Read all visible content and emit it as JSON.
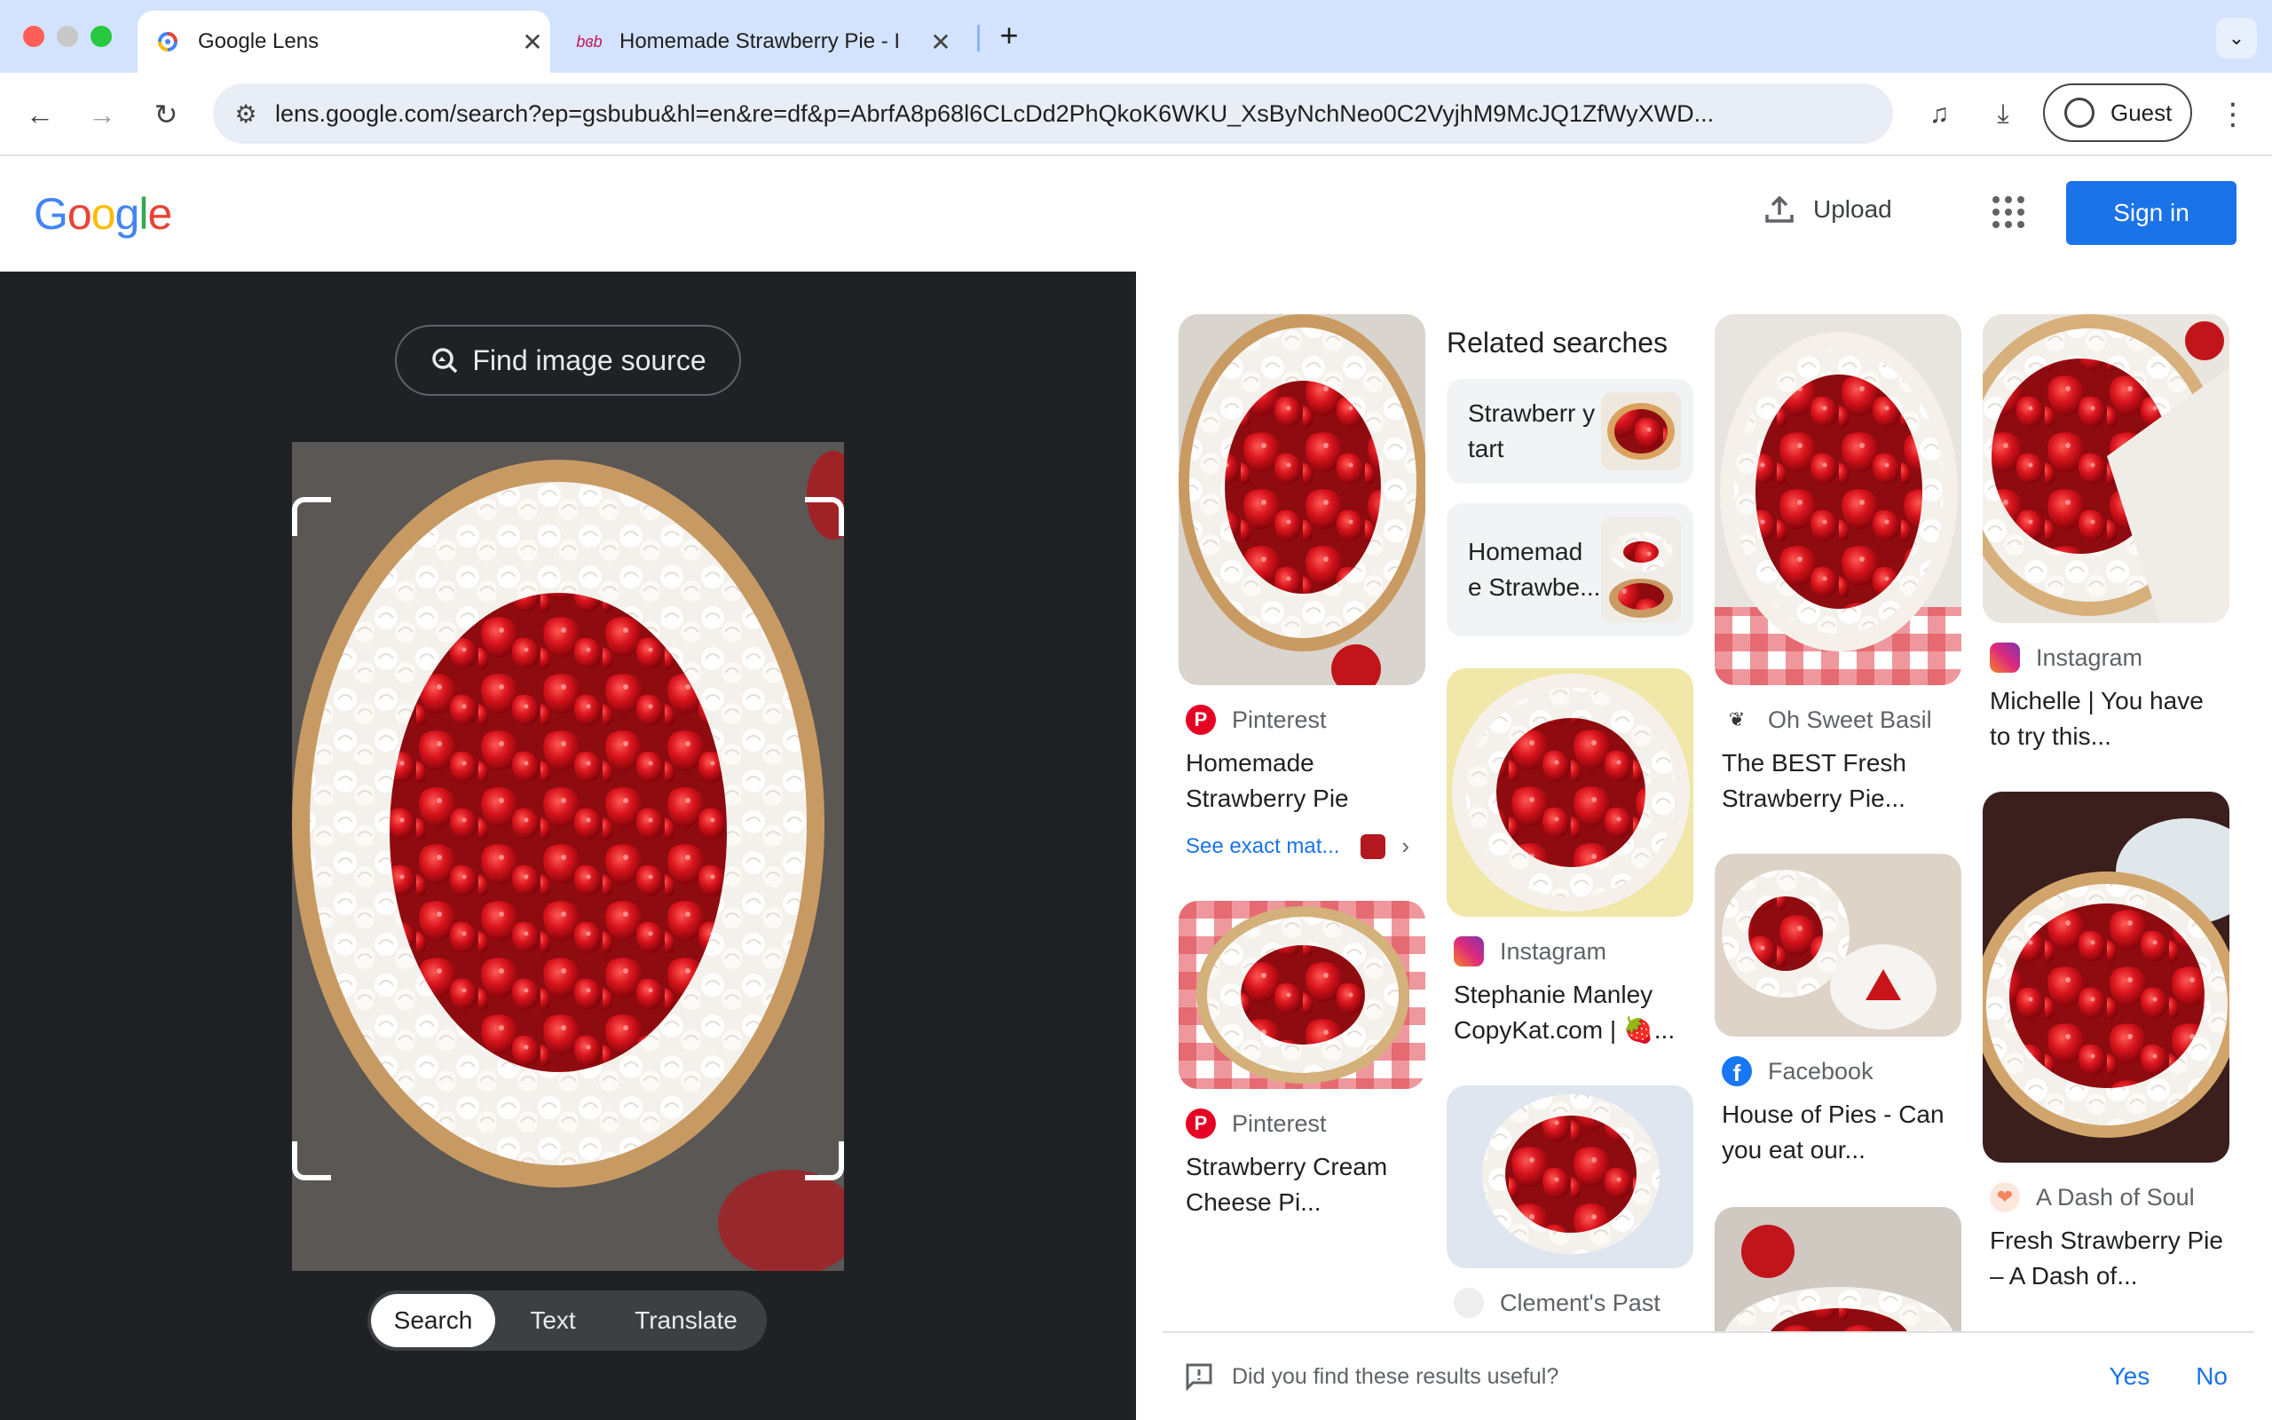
{
  "browser": {
    "tabs": [
      {
        "title": "Google Lens",
        "active": true
      },
      {
        "title": "Homemade Strawberry Pie - I",
        "active": false
      }
    ],
    "url": "lens.google.com/search?ep=gsbubu&hl=en&re=df&p=AbrfA8p68l6CLcDd2PhQkoK6WKU_XsByNchNeo0C2VyjhM9McJQ1ZfWyXWD...",
    "profile_label": "Guest"
  },
  "header": {
    "logo": "Google",
    "upload_label": "Upload",
    "signin_label": "Sign in"
  },
  "lens": {
    "find_source_label": "Find image source",
    "modes": [
      "Search",
      "Text",
      "Translate"
    ],
    "selected_mode": "Search"
  },
  "results": {
    "col1": [
      {
        "source": "Pinterest",
        "title": "Homemade Strawberry Pie",
        "exact_match": "See exact mat..."
      },
      {
        "source": "Pinterest",
        "title": "Strawberry Cream Cheese Pi..."
      }
    ],
    "related": {
      "heading": "Related searches",
      "items": [
        {
          "label": "Strawberr y tart"
        },
        {
          "label": "Homemad e Strawbe..."
        }
      ]
    },
    "col2": [
      {
        "source": "Instagram",
        "title": "Stephanie Manley CopyKat.com | 🍓..."
      },
      {
        "source": "Clement's Past"
      }
    ],
    "col3": [
      {
        "source": "Oh Sweet Basil",
        "title": "The BEST Fresh Strawberry Pie..."
      },
      {
        "source": "Facebook",
        "title": "House of Pies - Can you eat our..."
      }
    ],
    "col4": [
      {
        "source": "Instagram",
        "title": "Michelle | You have to try this..."
      },
      {
        "source": "A Dash of Soul",
        "title": "Fresh Strawberry Pie – A Dash of..."
      }
    ]
  },
  "feedback": {
    "question": "Did you find these results useful?",
    "yes": "Yes",
    "no": "No"
  },
  "colors": {
    "accent": "#1a73e8",
    "tabstrip": "#d3e3fd",
    "lens_dark": "#202124"
  }
}
